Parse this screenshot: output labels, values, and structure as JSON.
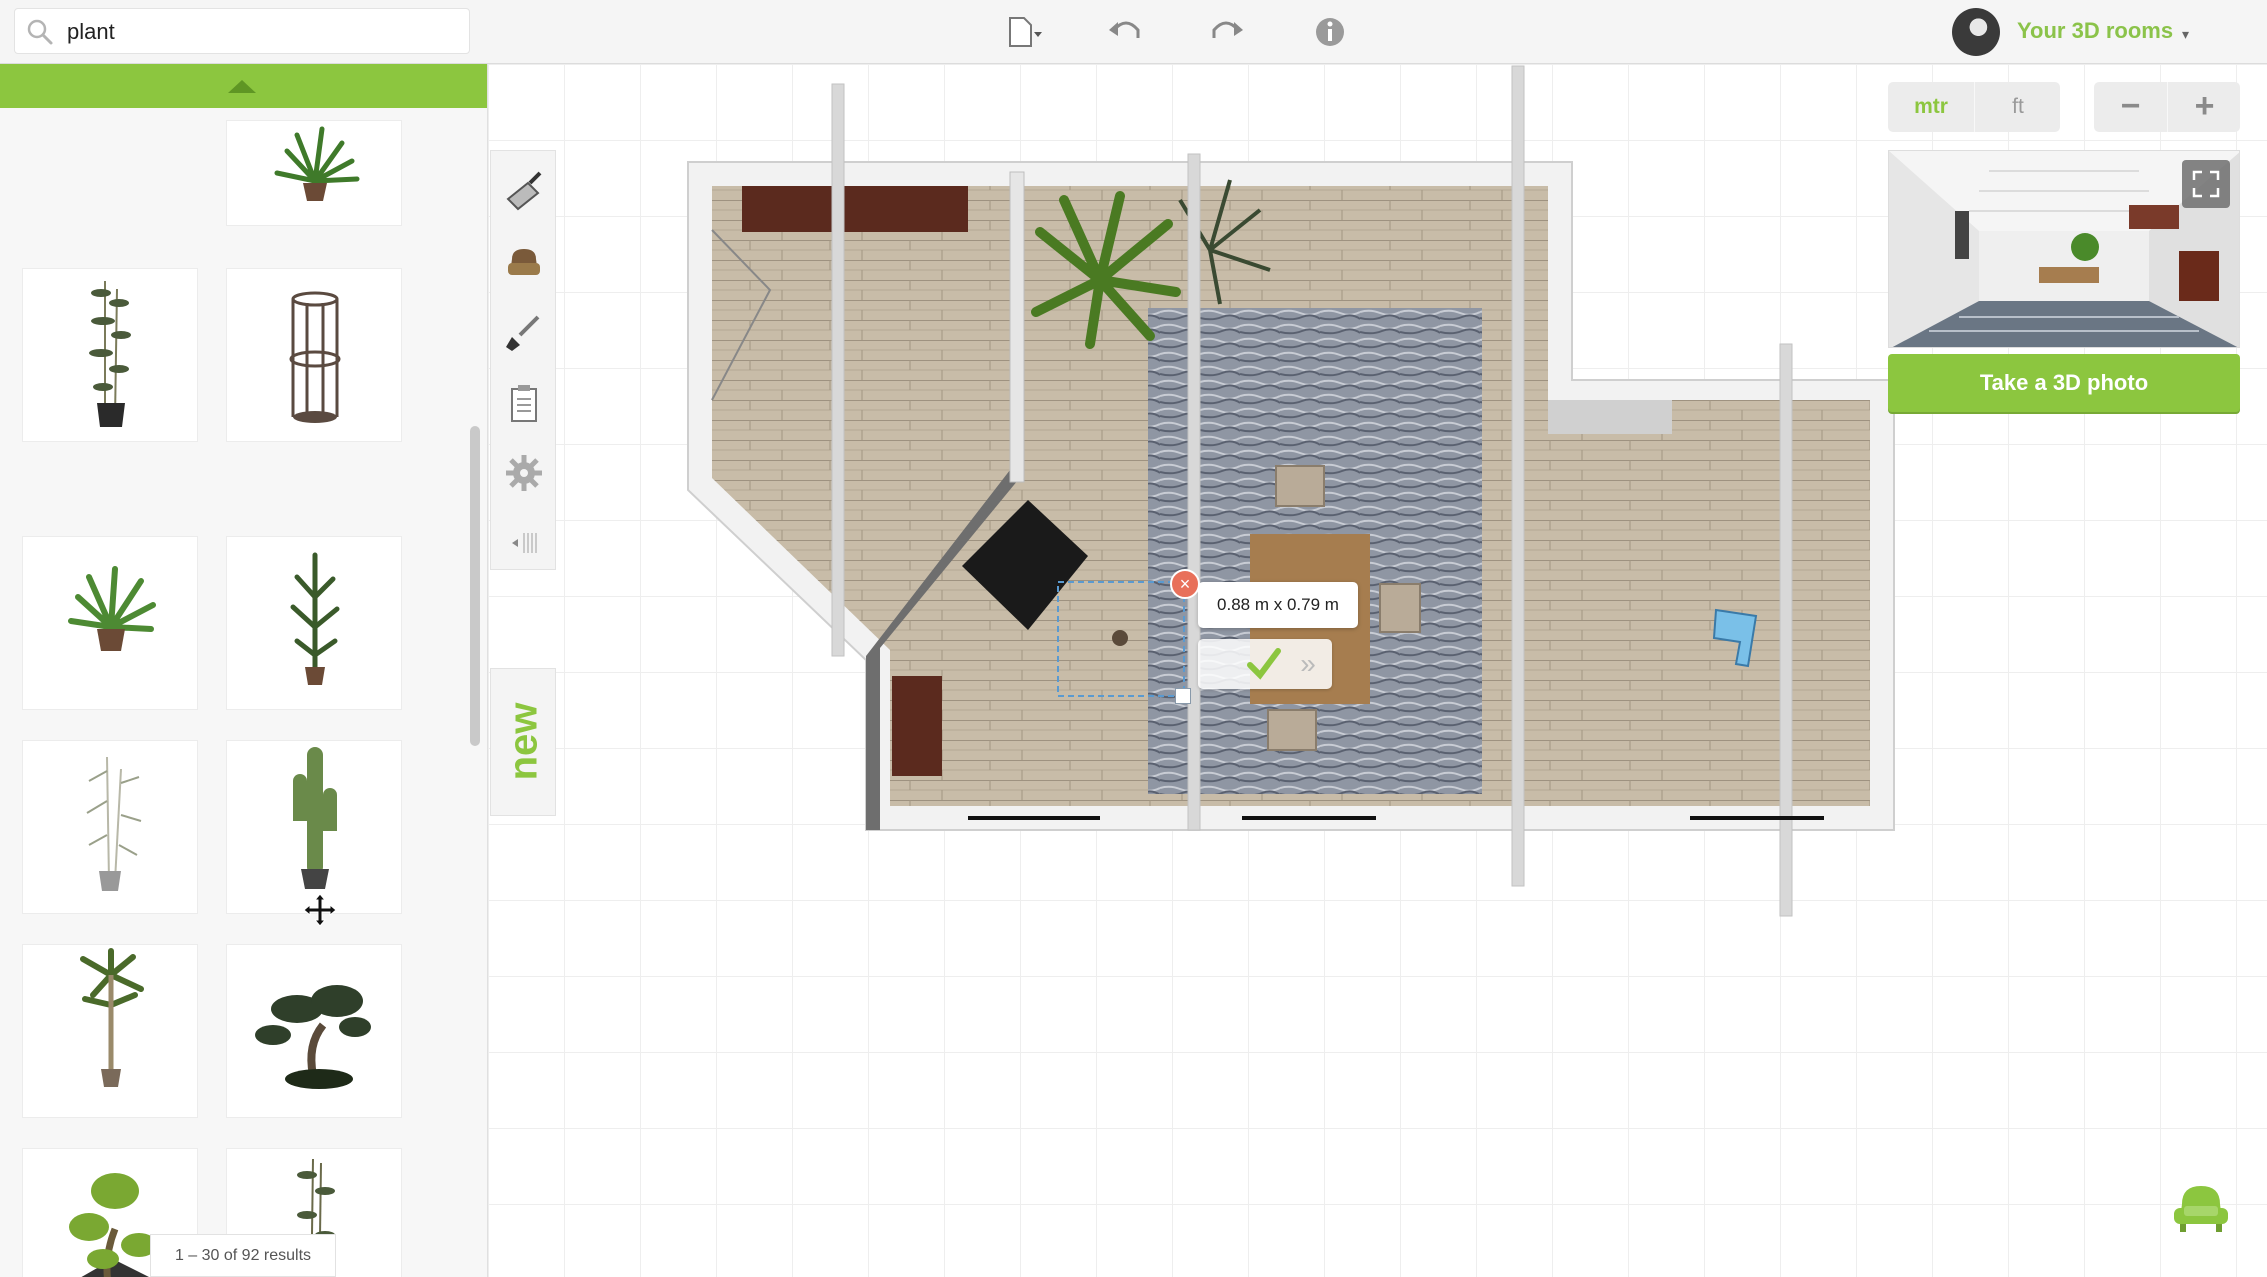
{
  "search": {
    "value": "plant",
    "icon": "search-icon"
  },
  "toolbar": {
    "items": [
      {
        "name": "file-menu-icon",
        "icon": "document-icon"
      },
      {
        "name": "undo-icon",
        "icon": "undo-arrow-icon"
      },
      {
        "name": "redo-icon",
        "icon": "redo-arrow-icon"
      },
      {
        "name": "info-icon",
        "icon": "info-icon"
      }
    ]
  },
  "user": {
    "label": "Your 3D rooms",
    "caret": "▾"
  },
  "catalog": {
    "items": [
      {
        "name": "potted-palm"
      },
      {
        "name": "bamboo-plant"
      },
      {
        "name": "wire-cage-planter"
      },
      {
        "name": "potted-palm-small"
      },
      {
        "name": "tall-spiky-plant"
      },
      {
        "name": "white-bamboo"
      },
      {
        "name": "cactus"
      },
      {
        "name": "small-palm-tree"
      },
      {
        "name": "bonsai-tree"
      },
      {
        "name": "bonsai-in-square-planter"
      },
      {
        "name": "tall-bamboo"
      }
    ],
    "results_text": "1 – 30 of 92 results"
  },
  "tools": [
    {
      "name": "build-walls-tool",
      "icon": "trowel-icon"
    },
    {
      "name": "furniture-tool",
      "icon": "armchair-icon"
    },
    {
      "name": "paint-tool",
      "icon": "paintbrush-icon"
    },
    {
      "name": "list-tool",
      "icon": "clipboard-icon"
    },
    {
      "name": "settings-tool",
      "icon": "gear-icon"
    },
    {
      "name": "collapse-tool",
      "icon": "chevron-left-icon"
    }
  ],
  "new_tab": {
    "label": "new"
  },
  "selection": {
    "dimensions": "0.88 m x 0.79 m",
    "delete_glyph": "×",
    "forward_glyph": "»"
  },
  "units": {
    "metric": "mtr",
    "imperial": "ft",
    "active": "mtr"
  },
  "zoom": {
    "out": "−",
    "in": "+"
  },
  "photo_button": {
    "label": "Take a 3D photo"
  },
  "colors": {
    "accent": "#8cc63f",
    "delete": "#e8705a",
    "floor": "#c7bba7"
  }
}
